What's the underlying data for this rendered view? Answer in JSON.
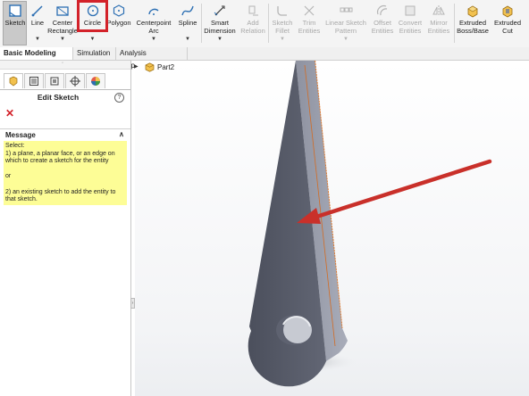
{
  "ribbon": {
    "tools": [
      {
        "id": "sketch",
        "label1": "Sketch",
        "label2": "",
        "icon": "sketch-icon",
        "enabled": true,
        "caret": false
      },
      {
        "id": "line",
        "label1": "Line",
        "label2": "",
        "icon": "line-icon",
        "enabled": true,
        "caret": true
      },
      {
        "id": "center-rectangle",
        "label1": "Center",
        "label2": "Rectangle",
        "icon": "center-rectangle-icon",
        "enabled": true,
        "caret": true
      },
      {
        "id": "circle",
        "label1": "Circle",
        "label2": "",
        "icon": "circle-icon",
        "enabled": true,
        "caret": true
      },
      {
        "id": "polygon",
        "label1": "Polygon",
        "label2": "",
        "icon": "polygon-icon",
        "enabled": true,
        "caret": false
      },
      {
        "id": "centerpoint-arc",
        "label1": "Centerpoint",
        "label2": "Arc",
        "icon": "arc-icon",
        "enabled": true,
        "caret": true
      },
      {
        "id": "spline",
        "label1": "Spline",
        "label2": "",
        "icon": "spline-icon",
        "enabled": true,
        "caret": true
      },
      {
        "id": "smart-dimension",
        "label1": "Smart",
        "label2": "Dimension",
        "icon": "smart-dimension-icon",
        "enabled": true,
        "caret": true
      },
      {
        "id": "add-relation",
        "label1": "Add",
        "label2": "Relation",
        "icon": "add-relation-icon",
        "enabled": false,
        "caret": false
      },
      {
        "id": "sketch-fillet",
        "label1": "Sketch",
        "label2": "Fillet",
        "icon": "sketch-fillet-icon",
        "enabled": false,
        "caret": true
      },
      {
        "id": "trim-entities",
        "label1": "Trim",
        "label2": "Entities",
        "icon": "trim-icon",
        "enabled": false,
        "caret": false
      },
      {
        "id": "linear-sketch-pattern",
        "label1": "Linear Sketch",
        "label2": "Pattern",
        "icon": "linear-pattern-icon",
        "enabled": false,
        "caret": true
      },
      {
        "id": "offset-entities",
        "label1": "Offset",
        "label2": "Entities",
        "icon": "offset-icon",
        "enabled": false,
        "caret": false
      },
      {
        "id": "convert-entities",
        "label1": "Convert",
        "label2": "Entities",
        "icon": "convert-icon",
        "enabled": false,
        "caret": false
      },
      {
        "id": "mirror-entities",
        "label1": "Mirror",
        "label2": "Entities",
        "icon": "mirror-icon",
        "enabled": false,
        "caret": false
      },
      {
        "id": "extruded-boss",
        "label1": "Extruded",
        "label2": "Boss/Base",
        "icon": "extruded-boss-icon",
        "enabled": true,
        "caret": false
      },
      {
        "id": "extruded-cut",
        "label1": "Extruded",
        "label2": "Cut",
        "icon": "extruded-cut-icon",
        "enabled": true,
        "caret": false
      }
    ]
  },
  "tabs": [
    {
      "label": "Basic Modeling Tools",
      "active": true
    },
    {
      "label": "Simulation",
      "active": false
    },
    {
      "label": "Analysis Preparation",
      "active": false
    }
  ],
  "panel": {
    "title": "Edit Sketch",
    "help_glyph": "?",
    "cancel_glyph": "✕",
    "message_header": "Message",
    "message_lines": [
      "Select:",
      "1) a plane, a planar face, or an edge on which to create a sketch for the entity",
      "",
      "or",
      "",
      "2) an existing sketch to add the entity to that sketch."
    ]
  },
  "tree": {
    "part_name": "Part2"
  },
  "colors": {
    "highlight": "#d3222a",
    "part_face": "#565a67",
    "message_bg": "#fdfd96"
  }
}
